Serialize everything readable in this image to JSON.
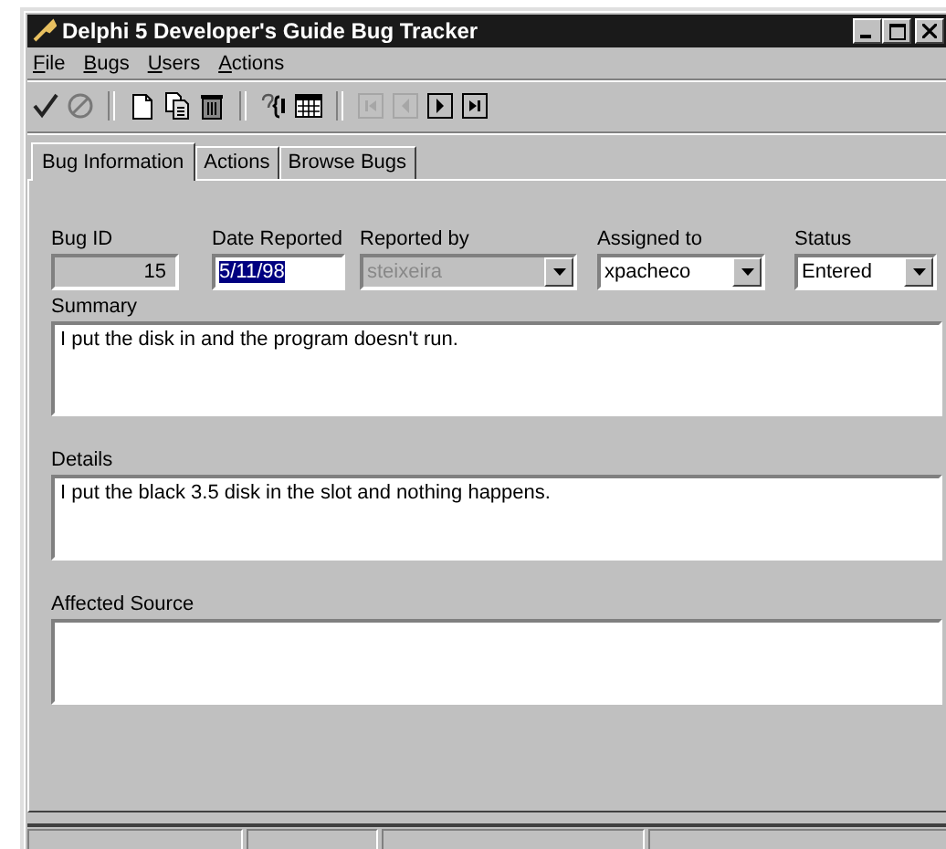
{
  "window": {
    "title": "Delphi 5 Developer's Guide Bug Tracker"
  },
  "menu": [
    {
      "accel": "F",
      "rest": "ile"
    },
    {
      "accel": "B",
      "rest": "ugs"
    },
    {
      "accel": "U",
      "rest": "sers"
    },
    {
      "accel": "A",
      "rest": "ctions"
    }
  ],
  "toolbar": [
    {
      "kind": "check",
      "disabled": false
    },
    {
      "kind": "cancel",
      "disabled": true
    },
    {
      "kind": "separator"
    },
    {
      "kind": "new",
      "disabled": false
    },
    {
      "kind": "copy",
      "disabled": false
    },
    {
      "kind": "delete",
      "disabled": false
    },
    {
      "kind": "separator"
    },
    {
      "kind": "help",
      "disabled": false
    },
    {
      "kind": "calendar",
      "disabled": false
    },
    {
      "kind": "separator"
    },
    {
      "kind": "first",
      "disabled": true
    },
    {
      "kind": "prior",
      "disabled": true
    },
    {
      "kind": "next",
      "disabled": false
    },
    {
      "kind": "last",
      "disabled": false
    }
  ],
  "tabs": [
    {
      "label": "Bug Information",
      "selected": true
    },
    {
      "label": "Actions",
      "selected": false
    },
    {
      "label": "Browse Bugs",
      "selected": false
    }
  ],
  "fields": [
    {
      "label": "Bug ID",
      "kind": "readonly",
      "value": "15",
      "disabled": false,
      "text_selected": false
    },
    {
      "label": "Date Reported",
      "kind": "edit",
      "value": "5/11/98",
      "disabled": false,
      "text_selected": true
    },
    {
      "label": "Reported by",
      "kind": "combo",
      "value": "steixeira",
      "disabled": true,
      "text_selected": false
    },
    {
      "label": "Assigned to",
      "kind": "combo",
      "value": "xpacheco",
      "disabled": false,
      "text_selected": false
    },
    {
      "label": "Status",
      "kind": "combo",
      "value": "Entered",
      "disabled": false,
      "text_selected": false
    }
  ],
  "memos": [
    {
      "label": "Summary",
      "value": "I put the disk in and the program doesn't run."
    },
    {
      "label": "Details",
      "value": "I put the black 3.5 disk in the slot and nothing happens."
    },
    {
      "label": "Affected Source"
    }
  ]
}
